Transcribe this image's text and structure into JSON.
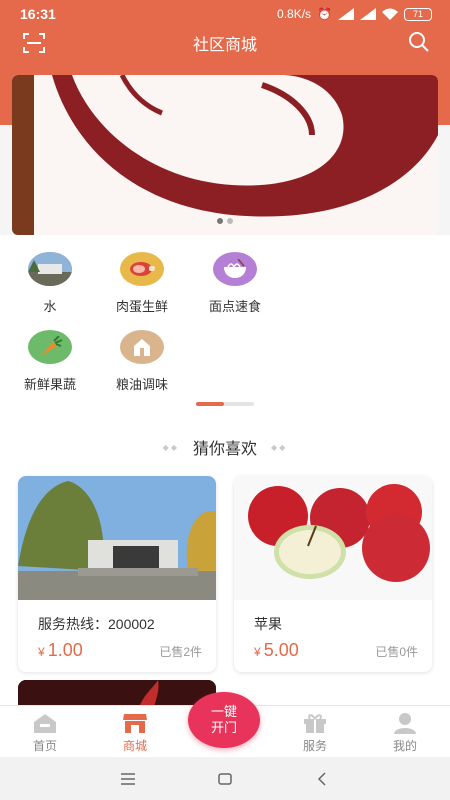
{
  "status": {
    "time": "16:31",
    "speed": "0.8K/s",
    "battery": "71"
  },
  "topbar": {
    "title": "社区商城"
  },
  "categories": [
    {
      "label": "水",
      "icon": "building-photo-icon",
      "color": "#6b8fb3"
    },
    {
      "label": "肉蛋生鲜",
      "icon": "meat-icon",
      "color": "#e8b84a"
    },
    {
      "label": "面点速食",
      "icon": "noodle-bowl-icon",
      "color": "#b57fd6"
    },
    {
      "label": "新鲜果蔬",
      "icon": "carrot-icon",
      "color": "#6dbb6a"
    },
    {
      "label": "粮油调味",
      "icon": "house-icon",
      "color": "#d9b48c"
    }
  ],
  "section": {
    "title": "猜你喜欢"
  },
  "products": [
    {
      "name": "服务热线：200002",
      "currency": "¥",
      "price": "1.00",
      "sold": "已售2件"
    },
    {
      "name": "苹果",
      "currency": "¥",
      "price": "5.00",
      "sold": "已售0件"
    }
  ],
  "tabbar": {
    "tabs": [
      {
        "label": "首页",
        "icon": "home-icon"
      },
      {
        "label": "商城",
        "icon": "shop-icon"
      },
      {
        "label": "服务",
        "icon": "gift-icon"
      },
      {
        "label": "我的",
        "icon": "user-icon"
      }
    ],
    "fab_line1": "一键",
    "fab_line2": "开门"
  },
  "colors": {
    "accent": "#e56a4c",
    "fab": "#e8335a"
  }
}
